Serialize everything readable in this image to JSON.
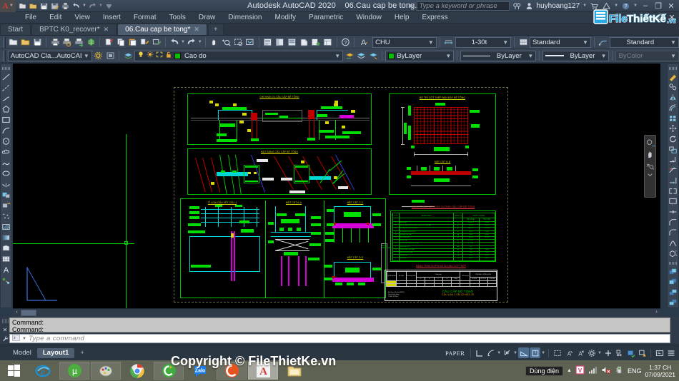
{
  "app": {
    "title": "Autodesk AutoCAD 2020",
    "document": "06.Cau cap be tong.dwg",
    "logo_letter": "A"
  },
  "titlebar": {
    "search_placeholder": "Type a keyword or phrase",
    "user": "huyhoang127",
    "minimize": "–",
    "restore": "❐",
    "close": "✕",
    "quick_access": [
      "new-icon",
      "open-icon",
      "save-icon",
      "saveas-icon",
      "plot-icon",
      "undo-icon",
      "redo-icon",
      "customize-icon"
    ],
    "right_icons": [
      "search-go-icon",
      "user-icon",
      "cart-icon",
      "autodesk-icon",
      "help-icon"
    ]
  },
  "menubar": {
    "items": [
      "File",
      "Edit",
      "View",
      "Insert",
      "Format",
      "Tools",
      "Draw",
      "Dimension",
      "Modify",
      "Parametric",
      "Window",
      "Help",
      "Express"
    ],
    "doc_minimize": "–",
    "doc_restore": "❐",
    "doc_close": "✕"
  },
  "filetabs": {
    "tabs": [
      {
        "label": "Start",
        "active": false,
        "closable": false
      },
      {
        "label": "BPTC K0_recover*",
        "active": false,
        "closable": true
      },
      {
        "label": "06.Cau cap be tong*",
        "active": true,
        "closable": true
      }
    ],
    "close_glyph": "✕",
    "new_tab": "+"
  },
  "toolbar_row1": {
    "icons": [
      "new-icon",
      "open-icon",
      "save-icon",
      "plot-icon",
      "plot-preview-icon",
      "publish-icon",
      "3dprint-icon",
      "cut-icon",
      "copy-icon",
      "paste-icon",
      "matchprop-icon",
      "blockeditor-icon",
      "undo-icon",
      "redo-icon",
      "pan-icon",
      "zoom-realtime-icon",
      "zoom-window-icon",
      "zoom-previous-icon",
      "properties-icon",
      "designcenter-icon",
      "tool-palettes-icon",
      "sheetset-icon",
      "markup-icon",
      "layout-icon",
      "help-icon",
      "text-style-icon"
    ]
  },
  "toolbar_row2": {
    "workspace": "AutoCAD Cla...AutoCAD 201",
    "workspace_icons": [
      "gear-icon",
      "workspace-settings-icon"
    ],
    "layer_props_icon": "layer-properties-icon",
    "layer_state_icons": [
      "lightbulb-icon",
      "sun-icon",
      "freeze-icon",
      "unlock-icon"
    ],
    "layer_swatch": "#00c000",
    "layer_name": "Cao do",
    "layer_tools": [
      "layer-previous-icon",
      "layer-make-current-icon",
      "layer-match-icon"
    ],
    "color": "ByLayer",
    "color_swatch": "#00c000",
    "linetype": "ByLayer",
    "lineweight": "ByLayer",
    "plotstyle": "ByColor"
  },
  "toolbar_row1_right": {
    "text_style_icon": "text-style-icon",
    "text_style": "CHU",
    "dim_style_icon": "dimension-style-icon",
    "dim_style": "1-30t",
    "table_style_icon": "table-style-icon",
    "table_style": "Standard",
    "mleader_style_icon": "multileader-style-icon",
    "mleader_style": "Standard"
  },
  "left_palette": {
    "handle": "drag-handle",
    "icons": [
      "line-icon",
      "construction-line-icon",
      "polyline-icon",
      "polygon-icon",
      "rectangle-icon",
      "arc-icon",
      "circle-icon",
      "revcloud-icon",
      "spline-icon",
      "ellipse-icon",
      "ellipse-arc-icon",
      "insert-block-icon",
      "make-block-icon",
      "point-icon",
      "hatch-icon",
      "gradient-icon",
      "region-icon",
      "table-icon",
      "multiline-text-icon",
      "add-selected-icon"
    ]
  },
  "right_palette": {
    "handle": "drag-handle",
    "icons": [
      "erase-icon",
      "copy-object-icon",
      "mirror-icon",
      "offset-icon",
      "array-icon",
      "move-icon",
      "rotate-icon",
      "scale-icon",
      "stretch-icon",
      "trim-icon",
      "extend-icon",
      "break-icon",
      "break-at-point-icon",
      "join-icon",
      "chamfer-icon",
      "fillet-icon",
      "blend-curves-icon",
      "explode-icon"
    ],
    "handle2": "drag-handle",
    "icons2": [
      "draworder-front-icon",
      "draworder-back-icon",
      "draworder-above-icon",
      "draworder-below-icon"
    ]
  },
  "navbar": {
    "icons": [
      "viewcube-2d-icon",
      "pan-hand-icon",
      "zoom-extents-icon",
      "chevron-down-icon"
    ]
  },
  "canvas": {
    "background": "#000000",
    "crosshair_color": "#00d000",
    "scrollbar_left": "‹",
    "scrollbar_right": "›"
  },
  "drawing": {
    "sheet_border_color": "#6d6d48",
    "titles": {
      "top_left": "CHI NHÀI CU CẦU CẤP BÊ TÔNG",
      "middle_left": "MẶT BẰNG CẦU CẤP BÊ TÔNG",
      "top_right": "BỐ TRÍ CỘT THÉP BẢN ĐÁY BÊ TÔNG",
      "right_mid": "MẶT CẮT B-B",
      "bl_1": "TỈ LOẠI DẦU KẾT CẤU 1",
      "bl_2": "MẶT CẮT A-A",
      "bl_3": "MẶT CẮT C-C",
      "bl_4": "MẶT CẮT D-D",
      "table1": "BẢNG TỔNG HỢP KHỐI LƯỢNG CẦU CẤP BÊ TÔNG",
      "table2": "BẢNG TỔNG HỢP KHỐI LƯỢNG CỐT THÉP",
      "sheet_name_1": "CẦU CẤP BÊ TÔNG",
      "sheet_name_2": "CẦU LẠN 3 KM 22+663.78"
    },
    "table1": {
      "headers": [
        "STT",
        "HẠNG MỤC",
        "ĐƠN VỊ",
        "KHỐI LƯỢNG"
      ],
      "sub_headers": [
        "Tiêu chuẩn",
        "Thực hiện"
      ],
      "rows": [
        {
          "no": "1",
          "item": "Đào móng",
          "unit": "m³",
          "v1": "1 483.11",
          "v2": "14.005"
        },
        {
          "no": "2",
          "item": "Đắp đất đầm chặt K95 (cát cấp III và IV lấp đầy)",
          "unit": "m³",
          "v1": "153.42",
          "v2": "133.73"
        },
        {
          "no": "3",
          "item": "Bê tông lót M100 đá 4x6cm",
          "unit": "m³",
          "v1": "100.5.97",
          "v2": "1 100.43"
        },
        {
          "no": "4",
          "item": "Bê tông M250 đá 1x2cm",
          "unit": "m³",
          "v1": "53.90",
          "v2": "55.30"
        },
        {
          "no": "5",
          "item": "Cốt thép CÁC loại",
          "unit": "kg",
          "v1": "59.60",
          "v2": "62.00"
        },
        {
          "no": "6",
          "item": "Ván khuôn đúc",
          "unit": "m²",
          "v1": "382.16",
          "v2": "213.55"
        },
        {
          "no": "7",
          "item": "Đá hộc xây",
          "unit": "m³",
          "v1": "1 72.51",
          "v2": ""
        },
        {
          "no": "8",
          "item": "Chống thấm M200 đá 1x2cm",
          "unit": "cái",
          "v1": "1 70.68",
          "v2": ""
        },
        {
          "no": "9",
          "item": "Ống nhựa PVC",
          "unit": "mỗi",
          "v1": "68",
          "v2": ""
        },
        {
          "no": "10",
          "item": "Tường chắn - Đất đắp",
          "unit": "m³",
          "v1": "7.00",
          "v2": "8.00"
        },
        {
          "no": "",
          "item": "Mố và trụ cầu Tông",
          "unit": "cộ",
          "v1": "1.80",
          "v2": "2.50"
        },
        {
          "no": "",
          "item": "Tường thân",
          "unit": "cái",
          "v1": "64.20",
          "v2": "61.15"
        },
        {
          "no": "",
          "item": "Chân khối",
          "unit": "cái",
          "v1": "50.20",
          "v2": "53.15"
        }
      ]
    },
    "table2": {
      "headers": [
        "Tên\nBộ phận",
        "Ký hiệu",
        "Đường\nkính",
        "Chiều dài",
        "Số lượng",
        "TRỌNG LƯỢNG (KG)"
      ],
      "sub": [
        "a",
        "b",
        "c",
        "d",
        "Tổng",
        "1 thanh",
        "Số thanh",
        "Ø 6-10",
        "Ø 12-18",
        "Ø 20-28"
      ],
      "notes": [
        "Bê tông Cốt thép M250",
        "Ván khuôn thép",
        "TỔNG CỘNG :"
      ]
    }
  },
  "command": {
    "history": [
      "Command:",
      "Command:"
    ],
    "placeholder": "Type a command",
    "grip_icons": [
      "drag-dots-icon",
      "close-icon",
      "wrench-icon"
    ],
    "prompt_icon": "command-prompt-icon"
  },
  "statusbar": {
    "model_tab": "Model",
    "layout_tab": "Layout1",
    "add_layout": "+",
    "space": "PAPER",
    "icons": [
      "ortho-icon",
      "polar-tracking-icon",
      "osnap-icon",
      "otrack-icon",
      "lineweight-icon",
      "transparency-icon",
      "selection-cycling-icon",
      "annotation-visibility-icon",
      "annotation-scale-icon",
      "workspace-switch-icon",
      "hardware-accel-icon",
      "isolate-objects-icon",
      "fullscreen-icon",
      "customization-icon"
    ]
  },
  "taskbar": {
    "start": "windows-logo-icon",
    "items": [
      "internet-explorer-icon",
      "utorrent-icon",
      "paint-icon",
      "chrome-icon",
      "cocco-c-icon",
      "zalo-icon",
      "unikey-icon",
      "autocad-icon",
      "explorer-icon"
    ],
    "tray": {
      "battery_tooltip": "Dùng điện",
      "chevron": "▲",
      "icons": [
        "unikey-v-icon",
        "network-icon",
        "volume-muted-icon",
        "usb-device-icon"
      ],
      "language": "ENG",
      "time": "1:37 CH",
      "date": "07/09/2021"
    }
  },
  "watermark": {
    "logo_part1": "File",
    "logo_part2": "Thiết Kế",
    "logo_part3": ".vn",
    "copyright": "Copyright © FileThietKe.vn",
    "logo_color1": "#27a9e1",
    "logo_color2": "#ffffff"
  }
}
